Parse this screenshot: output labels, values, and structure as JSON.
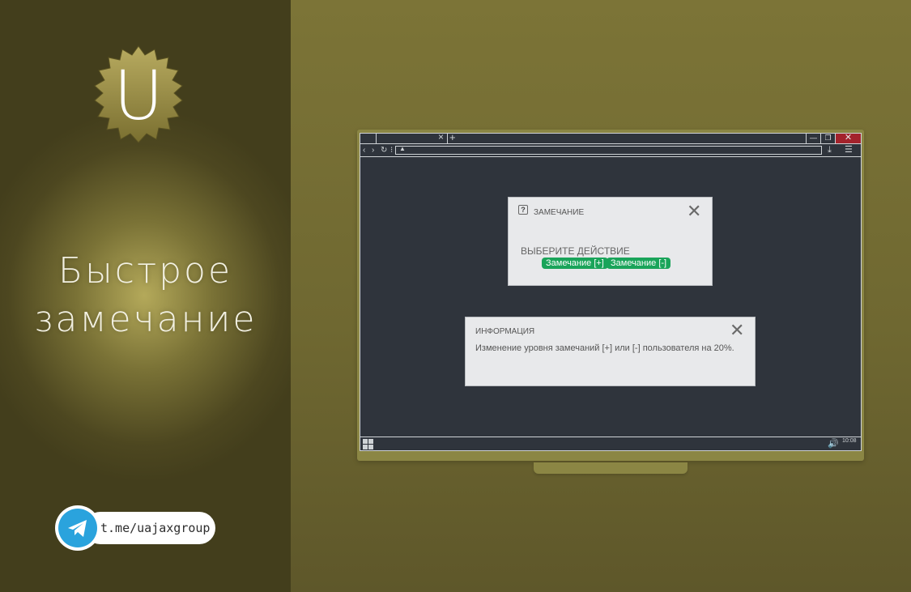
{
  "branding": {
    "logo_letter": "U",
    "slogan_line1": "Быстрое",
    "slogan_line2": "замечание",
    "telegram_link": "t.me/uajaxgroup"
  },
  "browser": {
    "tab_close": "×",
    "tab_add": "+",
    "win_min": "—",
    "win_max": "❐",
    "win_close": "✕",
    "icons": [
      "chevron-left-icon",
      "chevron-right-icon",
      "reload-icon",
      "lock-icon",
      "download-icon",
      "settings-icon"
    ]
  },
  "dialog_remark": {
    "help_glyph": "?",
    "title": "ЗАМЕЧАНИЕ",
    "close": "✕",
    "prompt": "ВЫБЕРИТЕ ДЕЙСТВИЕ",
    "btn_plus": "Замечание [+]",
    "btn_minus": "Замечание [-]"
  },
  "dialog_info": {
    "title": "ИНФОРМАЦИЯ",
    "close": "✕",
    "text": "Изменение уровня замечаний [+] или [-] пользователя на 20%."
  },
  "taskbar": {
    "clock": "10:08"
  },
  "colors": {
    "accent_green": "#1aa45a",
    "telegram_blue": "#2aa3dd",
    "close_red": "#a3232c",
    "screen_bg": "#2f343c"
  }
}
